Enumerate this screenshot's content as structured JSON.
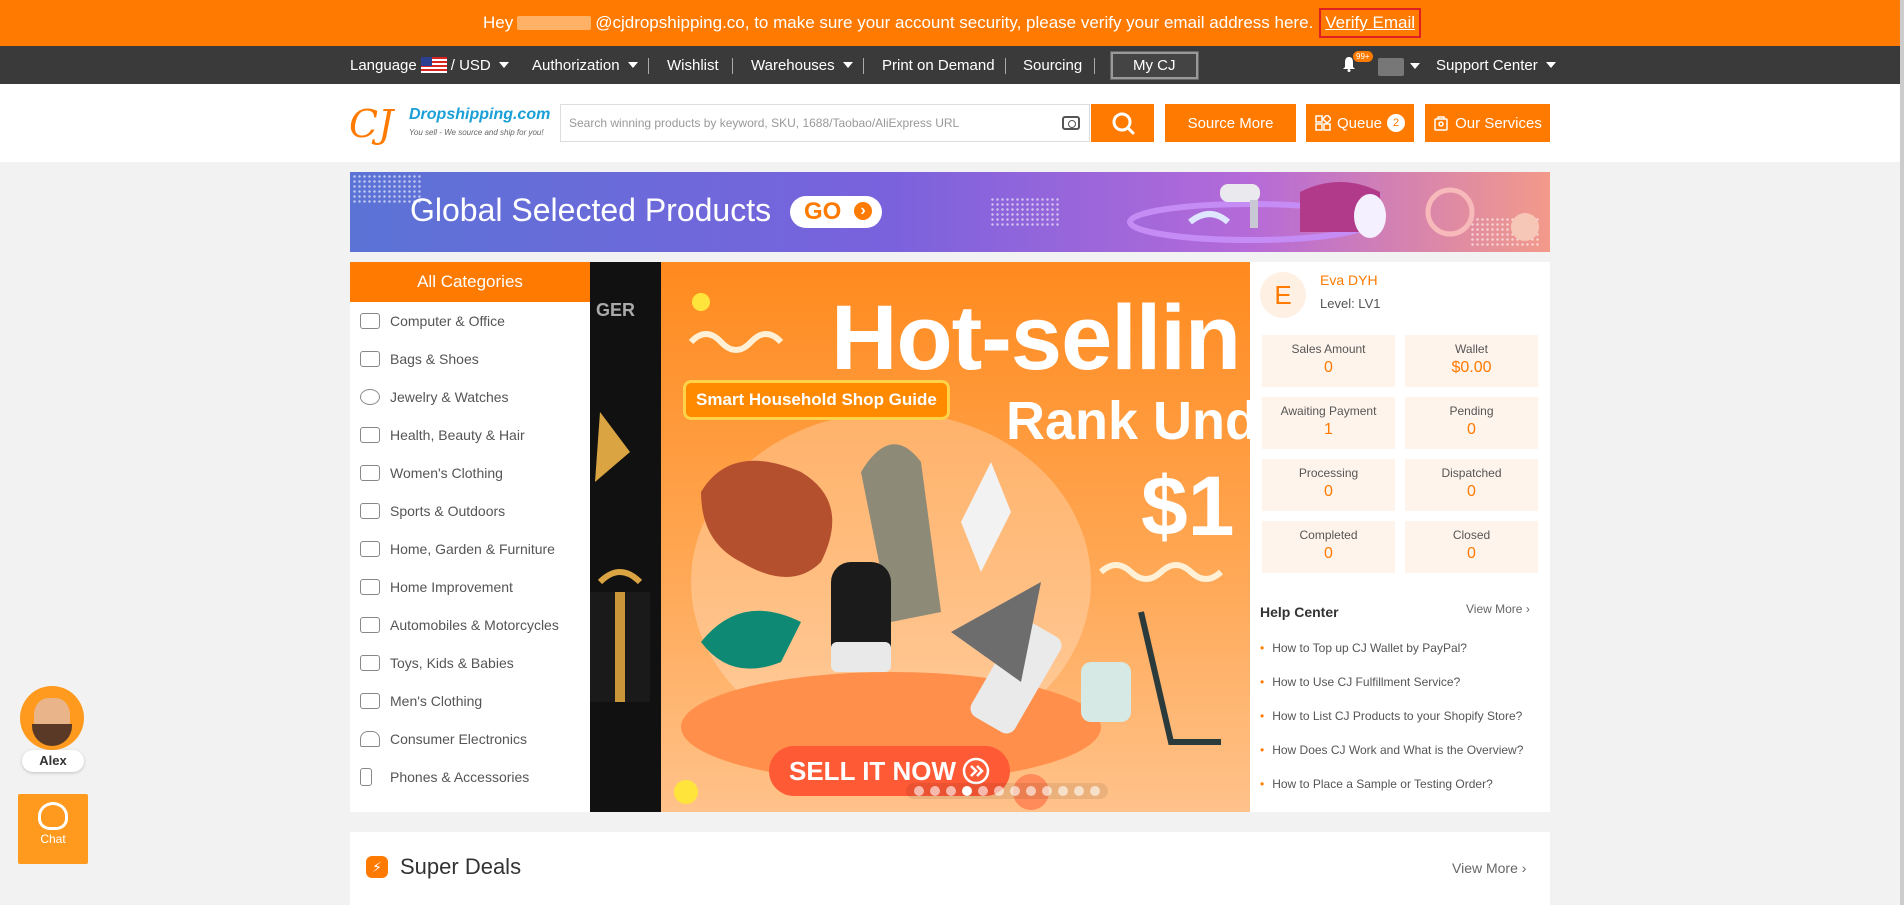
{
  "notice": {
    "greeting": "Hey",
    "email_suffix": "@cjdropshipping.co, to make sure your account security, please verify your email address here.",
    "verify_link": "Verify Email"
  },
  "nav": {
    "language": "Language",
    "currency": "/ USD",
    "authorization": "Authorization",
    "wishlist": "Wishlist",
    "warehouses": "Warehouses",
    "print_on_demand": "Print on Demand",
    "sourcing": "Sourcing",
    "my_cj": "My CJ",
    "notifications_badge": "99+",
    "support_center": "Support Center"
  },
  "header": {
    "logo_cj": "CJ",
    "logo_name": "Dropshipping.com",
    "logo_slogan": "You sell - We source and ship for you!",
    "search_placeholder": "Search winning products by keyword, SKU, 1688/Taobao/AliExpress URL",
    "source_more": "Source More",
    "queue": "Queue",
    "queue_count": "2",
    "our_services": "Our Services"
  },
  "global_banner": {
    "title": "Global Selected Products",
    "go": "GO"
  },
  "categories": {
    "heading": "All Categories",
    "items": [
      "Computer & Office",
      "Bags & Shoes",
      "Jewelry & Watches",
      "Health, Beauty & Hair",
      "Women's Clothing",
      "Sports & Outdoors",
      "Home, Garden & Furniture",
      "Home Improvement",
      "Automobiles & Motorcycles",
      "Toys, Kids & Babies",
      "Men's Clothing",
      "Consumer Electronics",
      "Phones & Accessories"
    ]
  },
  "main_banner": {
    "prev_fragment": "GER",
    "headline": "Hot-sellin",
    "subline": "Rank Und",
    "price": "$1",
    "guide_label": "Smart Household Shop Guide",
    "cta": "SELL IT NOW",
    "slide_count": 12,
    "active_slide": 4
  },
  "user_panel": {
    "avatar_letter": "E",
    "name": "Eva DYH",
    "level": "Level: LV1",
    "stats": [
      {
        "label": "Sales Amount",
        "value": "0"
      },
      {
        "label": "Wallet",
        "value": "$0.00"
      },
      {
        "label": "Awaiting Payment",
        "value": "1"
      },
      {
        "label": "Pending",
        "value": "0"
      },
      {
        "label": "Processing",
        "value": "0"
      },
      {
        "label": "Dispatched",
        "value": "0"
      },
      {
        "label": "Completed",
        "value": "0"
      },
      {
        "label": "Closed",
        "value": "0"
      }
    ],
    "help_title": "Help Center",
    "help_view_more": "View More",
    "help_items": [
      "How to Top up CJ Wallet by PayPal?",
      "How to Use CJ Fulfillment Service?",
      "How to List CJ Products to your Shopify Store?",
      "How Does CJ Work and What is the Overview?",
      "How to Place a Sample or Testing Order?"
    ]
  },
  "super_deals": {
    "title": "Super Deals",
    "view_more": "View More"
  },
  "widgets": {
    "agent_name": "Alex",
    "chat_label": "Chat"
  },
  "colors": {
    "accent": "#ff7a00",
    "nav_bg": "#3a3a3a",
    "page_bg": "#f2f2f2"
  }
}
